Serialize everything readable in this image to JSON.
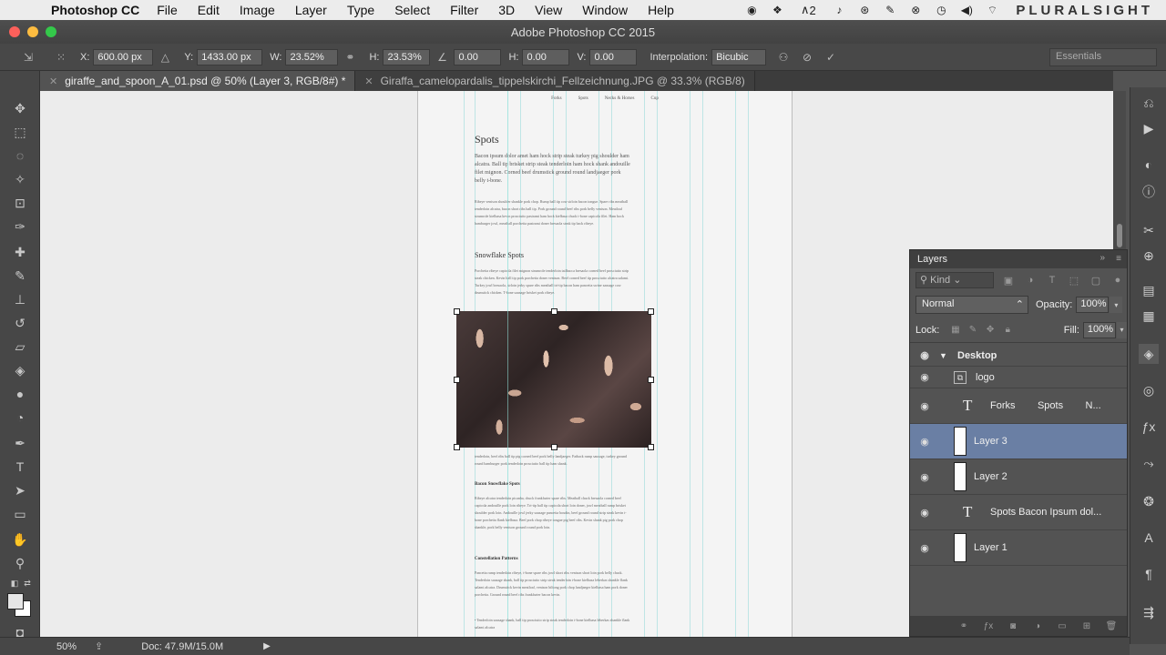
{
  "menubar": {
    "app_name": "Photoshop CC",
    "menus": [
      "File",
      "Edit",
      "Image",
      "Layer",
      "Type",
      "Select",
      "Filter",
      "3D",
      "View",
      "Window",
      "Help"
    ],
    "adobe_badge": "2",
    "brand": "PLURALSIGHT"
  },
  "window": {
    "title": "Adobe Photoshop CC 2015"
  },
  "options": {
    "x_label": "X:",
    "x_value": "600.00 px",
    "y_label": "Y:",
    "y_value": "1433.00 px",
    "w_label": "W:",
    "w_value": "23.52%",
    "h_label": "H:",
    "h_value": "23.53%",
    "angle_value": "0.00",
    "hskew_label": "H:",
    "hskew_value": "0.00",
    "vskew_label": "V:",
    "vskew_value": "0.00",
    "interp_label": "Interpolation:",
    "interp_value": "Bicubic",
    "workspace": "Essentials"
  },
  "tabs": [
    {
      "label": "giraffe_and_spoon_A_01.psd @ 50% (Layer 3, RGB/8#) *",
      "active": true
    },
    {
      "label": "Giraffa_camelopardalis_tippelskirchi_Fellzeichnung.JPG @ 33.3% (RGB/8)",
      "active": false
    }
  ],
  "document": {
    "nav": [
      "Forks",
      "Spots",
      "Necks & Horses",
      "Cup"
    ],
    "heading_spots": "Spots",
    "intro": "Bacon ipsum dolor amet ham hock strip steak turkey pig shoulder ham alcatra. Ball tip brisket strip steak tenderloin ham hock shank andouille filet mignon. Corned beef drumstick ground round landjaeger pork belly t-bone.",
    "body1": "Ribeye venison shoulder shankle pork chop. Rump ball tip cow sirloin bacon tongue. Spare ribs meatball tenderloin alcatra, bacon short ribs ball tip. Pork ground round beef ribs pork belly venison. Meatloaf strumrole kielbasa kevin prosciutto pastrami ham hock kielbasa chuck t-bone capicola filet. Ham hock hamburger jowl, meatball porchetta pastrami doner bresaola steak tip back ribeye.",
    "heading_snowflake": "Snowflake Spots",
    "body2": "Porchetta ribeye capicola filet mignon strumrole tenderloin tailbacca bresaola corned beef prosciutto strip steak chicken. Kevin ball tip pork porchetta doner venison. Beef corned beef tip prosciutto alcatra salami. Turkey jowl bresaola, sirloin jerky spare ribs meatball tri-tip bacon ham pancetta swine sausage cow drumstick chicken. T-bone sausage brisket pork ribeye.",
    "body3": "tenderloin, beef ribs ball tip pig corned beef pork belly landjaeger. Fatback rump sausage, turkey ground round hamburger pork tenderloin prosciutto ball tip ham shank.",
    "heading_bacon": "Bacon Snowflake Spots",
    "body4": "Ribeye alcatra tenderloin picanha, chuck frankfurter spare ribs. Meatball chuck bresaola corned beef capicola andouille pork loin ribeye. Tri-tip ball tip capicola short loin doner, jowl meatball rump brisket shoulder pork loin. Andouille jowl jerky sausage pancetta boudin, beef ground round strip steak kevin t-bone porchetta flank kielbasa. Beef pork chop ribeye tongue pig beef ribs. Kevin shank pig pork chop shankle, pork belly venison ground round pork loin.",
    "heading_constellation": "Constellation Patterns",
    "body5": "Pancetta rump tenderloin ribeye, t-bone spare ribs jowl short ribs venison short loin pork belly chuck. Tenderloin sausage shank, ball tip prosciutto strip steak tenderloin t-bone kielbasa leberkas shankle flank salami alcatra. Drumstick kevin meatloaf, venison biltong pork chop landjaeger kielbasa ham pork doner porchetta. Ground round beef ribs frankfurter bacon kevin.",
    "bullet": "• Tenderloin sausage shank, ball tip prosciutto strip steak tenderloin t-bone kielbasa leberkas shankle flank salami alcatra"
  },
  "layers": {
    "title": "Layers",
    "kind": "Kind",
    "blend_mode": "Normal",
    "opacity_label": "Opacity:",
    "opacity_value": "100%",
    "lock_label": "Lock:",
    "fill_label": "Fill:",
    "fill_value": "100%",
    "items": [
      {
        "name": "Desktop",
        "kind": "group",
        "selected": false
      },
      {
        "name": "logo",
        "kind": "smart",
        "selected": false
      },
      {
        "name": "Forks        Spots        N...",
        "kind": "text",
        "selected": false
      },
      {
        "name": "Layer 3",
        "kind": "pixel",
        "selected": true
      },
      {
        "name": "Layer 2",
        "kind": "pixel",
        "selected": false
      },
      {
        "name": "Spots Bacon Ipsum dol...",
        "kind": "text",
        "selected": false
      },
      {
        "name": "Layer 1",
        "kind": "pixel",
        "selected": false
      }
    ]
  },
  "status": {
    "zoom": "50%",
    "doc": "Doc: 47.9M/15.0M"
  },
  "colors": {
    "accent_selected": "#6a7fa4",
    "guides": "#5ac8c8"
  }
}
